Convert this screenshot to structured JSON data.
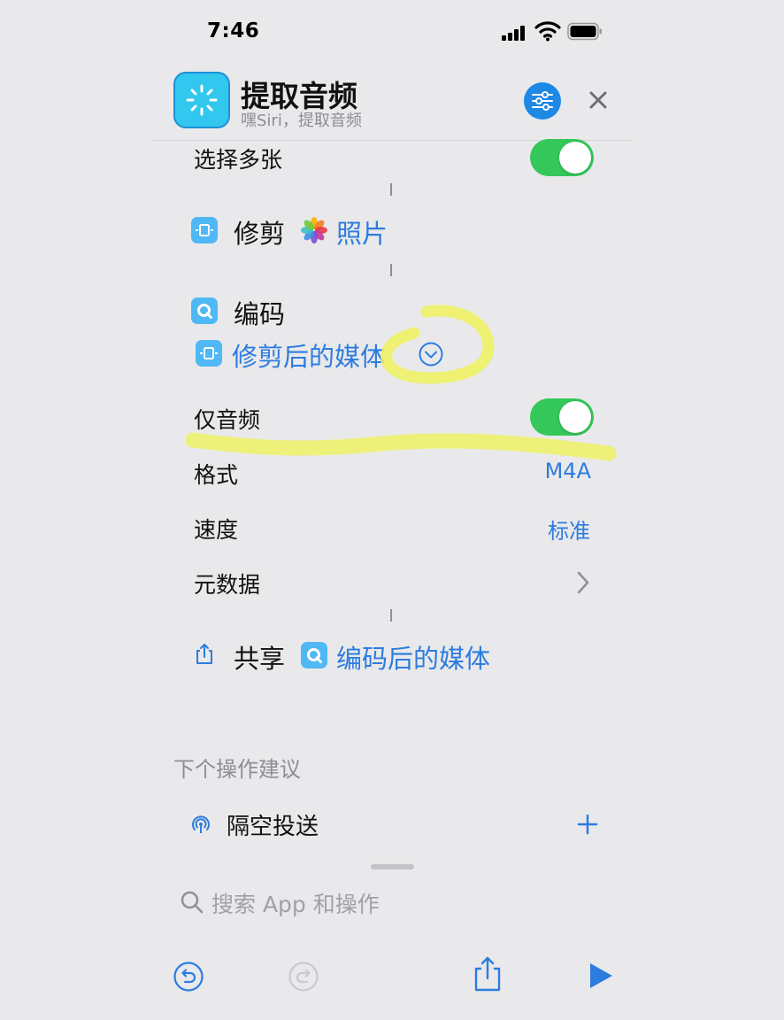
{
  "status_bar": {
    "time": "7:46"
  },
  "header": {
    "title": "提取音频",
    "subtitle": "嘿Siri，提取音频"
  },
  "rows": {
    "select_multiple": "选择多张",
    "trim_action": {
      "title": "修剪",
      "token": "照片"
    },
    "encode_action": {
      "title": "编码",
      "input_token": "修剪后的媒体"
    },
    "audio_only": "仅音频",
    "format": {
      "label": "格式",
      "value": "M4A"
    },
    "speed": {
      "label": "速度",
      "value": "标准"
    },
    "metadata": {
      "label": "元数据"
    },
    "share_action": {
      "title": "共享",
      "token": "编码后的媒体"
    }
  },
  "suggestions": {
    "header": "下个操作建议",
    "items": [
      {
        "label": "隔空投送"
      }
    ]
  },
  "search": {
    "placeholder": "搜索 App 和操作"
  },
  "colors": {
    "accent": "#2c7ce0",
    "toggle_on": "#34c759",
    "app_icon": "#32c7ee",
    "highlight": "#eef25c"
  },
  "icons": {
    "app": "magic-wand-icon",
    "settings": "sliders-icon",
    "close": "close-icon",
    "trim": "film-trim-icon",
    "photos": "photos-flower-icon",
    "encode": "quicktime-icon",
    "share": "share-icon",
    "airdrop": "airdrop-icon",
    "add": "plus-icon",
    "search": "search-icon",
    "undo": "undo-icon",
    "redo": "redo-icon",
    "play": "play-icon"
  }
}
